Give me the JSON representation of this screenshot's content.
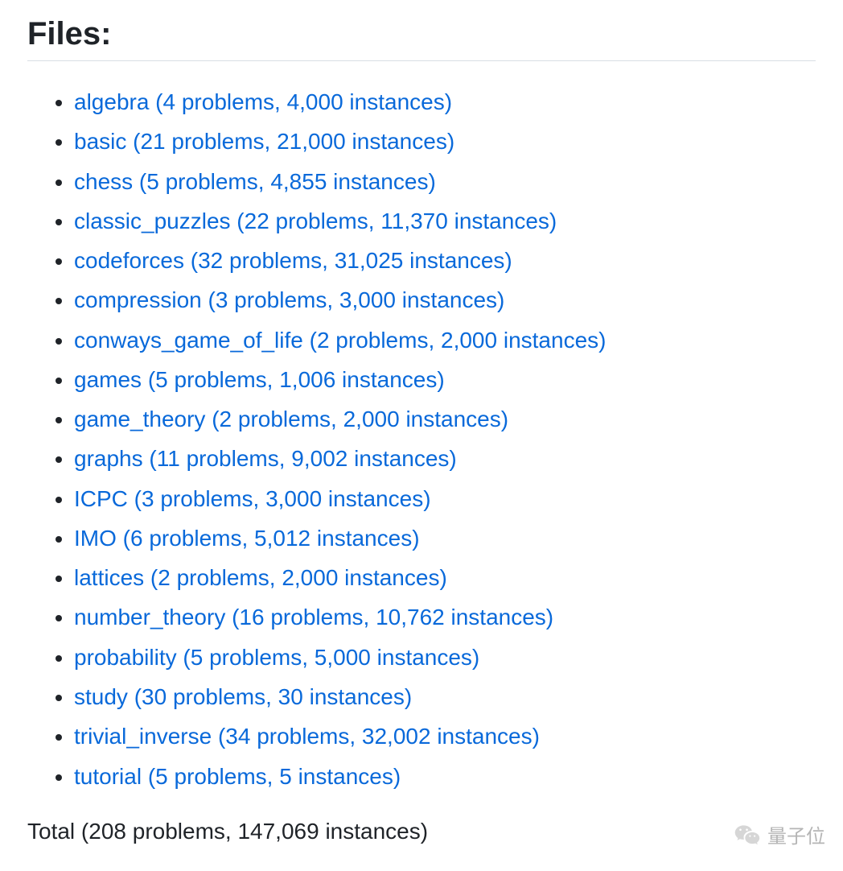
{
  "heading": "Files:",
  "files": [
    {
      "label": "algebra (4 problems, 4,000 instances)"
    },
    {
      "label": "basic (21 problems, 21,000 instances)"
    },
    {
      "label": "chess (5 problems, 4,855 instances)"
    },
    {
      "label": "classic_puzzles (22 problems, 11,370 instances)"
    },
    {
      "label": "codeforces (32 problems, 31,025 instances)"
    },
    {
      "label": "compression (3 problems, 3,000 instances)"
    },
    {
      "label": "conways_game_of_life (2 problems, 2,000 instances)"
    },
    {
      "label": "games (5 problems, 1,006 instances)"
    },
    {
      "label": "game_theory (2 problems, 2,000 instances)"
    },
    {
      "label": "graphs (11 problems, 9,002 instances)"
    },
    {
      "label": "ICPC (3 problems, 3,000 instances)"
    },
    {
      "label": "IMO (6 problems, 5,012 instances)"
    },
    {
      "label": "lattices (2 problems, 2,000 instances)"
    },
    {
      "label": "number_theory (16 problems, 10,762 instances)"
    },
    {
      "label": "probability (5 problems, 5,000 instances)"
    },
    {
      "label": "study (30 problems, 30 instances)"
    },
    {
      "label": "trivial_inverse (34 problems, 32,002 instances)"
    },
    {
      "label": "tutorial (5 problems, 5 instances)"
    }
  ],
  "total": "Total (208 problems, 147,069 instances)",
  "watermark_text": "量子位"
}
